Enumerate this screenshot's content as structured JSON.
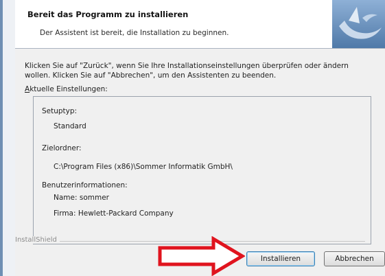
{
  "header": {
    "title": "Bereit das Programm zu installieren",
    "subtitle": "Der Assistent ist bereit, die Installation zu beginnen."
  },
  "intro": {
    "line1": "Klicken Sie auf \"Zurück\", wenn Sie Ihre Installationseinstellungen überprüfen oder ändern",
    "line2": "wollen. Klicken Sie auf \"Abbrechen\", um den Assistenten zu beenden."
  },
  "settings": {
    "label_first": "A",
    "label_rest": "ktuelle Einstellungen:",
    "setup_type_label": "Setuptyp:",
    "setup_type_value": "Standard",
    "target_folder_label": "Zielordner:",
    "target_folder_value": "C:\\Program Files (x86)\\Sommer Informatik GmbH\\",
    "user_info_label": "Benutzerinformationen:",
    "name_line": "Name: sommer",
    "company_line": "Firma: Hewlett-Packard Company"
  },
  "footer": {
    "installshield": "InstallShield",
    "install_button": "Installieren",
    "cancel_button": "Abbrechen"
  },
  "colors": {
    "accent_arrow": "#e0141e",
    "logo_bg": "#5f88b5"
  }
}
